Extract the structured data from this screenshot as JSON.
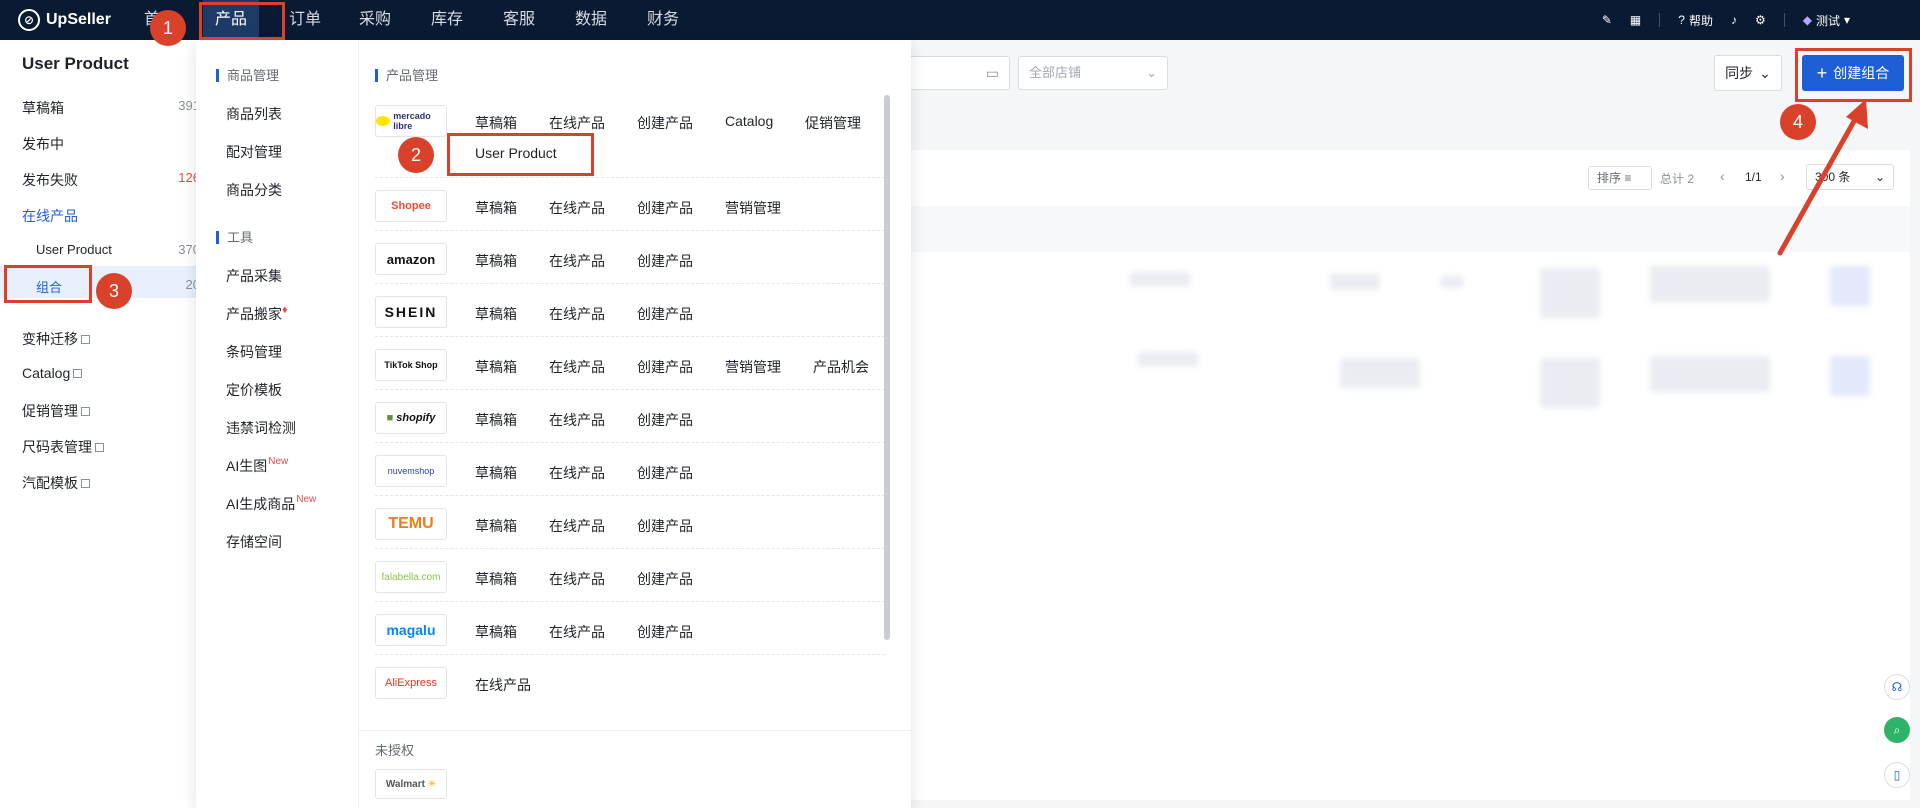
{
  "topnav": {
    "logo": "UpSeller",
    "items": [
      "首",
      "产品",
      "订单",
      "采购",
      "库存",
      "客服",
      "数据",
      "财务"
    ],
    "help": "帮助",
    "user": "测试"
  },
  "sidebar": {
    "title": "User Product",
    "items": [
      {
        "label": "草稿箱",
        "count": "391"
      },
      {
        "label": "发布中",
        "count": ""
      },
      {
        "label": "发布失败",
        "count": "126"
      },
      {
        "label": "在线产品",
        "count": ""
      },
      {
        "label": "User Product",
        "count": "370"
      },
      {
        "label": "组合",
        "count": "20"
      },
      {
        "label": "变种迁移",
        "count": ""
      },
      {
        "label": "Catalog",
        "count": ""
      },
      {
        "label": "促销管理",
        "count": ""
      },
      {
        "label": "尺码表管理",
        "count": ""
      },
      {
        "label": "汽配模板",
        "count": ""
      }
    ]
  },
  "toolbar": {
    "store_placeholder": "全部店铺",
    "sync": "同步",
    "create": "创建组合",
    "sort": "排序",
    "total": "总计 2",
    "page": "1/1",
    "per_page": "300 条"
  },
  "menu": {
    "left_section1": "商品管理",
    "left_items1": [
      "商品列表",
      "配对管理",
      "商品分类"
    ],
    "left_section2": "工具",
    "left_items2": [
      "产品采集",
      "产品搬家",
      "条码管理",
      "定价模板",
      "违禁词检测",
      "AI生图",
      "AI生成商品",
      "存储空间"
    ],
    "new_tag": "New",
    "right_section": "产品管理",
    "platforms": [
      {
        "logo": "mercado libre",
        "links": [
          "草稿箱",
          "在线产品",
          "创建产品",
          "Catalog",
          "促销管理"
        ],
        "sub": "User Product"
      },
      {
        "logo": "Shopee",
        "links": [
          "草稿箱",
          "在线产品",
          "创建产品",
          "营销管理"
        ]
      },
      {
        "logo": "amazon",
        "links": [
          "草稿箱",
          "在线产品",
          "创建产品"
        ]
      },
      {
        "logo": "SHEIN",
        "links": [
          "草稿箱",
          "在线产品",
          "创建产品"
        ]
      },
      {
        "logo": "TikTok Shop",
        "links": [
          "草稿箱",
          "在线产品",
          "创建产品",
          "营销管理",
          "产品机会"
        ]
      },
      {
        "logo": "shopify",
        "links": [
          "草稿箱",
          "在线产品",
          "创建产品"
        ]
      },
      {
        "logo": "nuvemshop",
        "links": [
          "草稿箱",
          "在线产品",
          "创建产品"
        ]
      },
      {
        "logo": "TEMU",
        "links": [
          "草稿箱",
          "在线产品",
          "创建产品"
        ]
      },
      {
        "logo": "falabella.com",
        "links": [
          "草稿箱",
          "在线产品",
          "创建产品"
        ]
      },
      {
        "logo": "magalu",
        "links": [
          "草稿箱",
          "在线产品",
          "创建产品"
        ]
      },
      {
        "logo": "AliExpress",
        "links": [
          "在线产品"
        ]
      }
    ],
    "unauth_title": "未授权",
    "unauth_logo": "Walmart"
  },
  "annotations": [
    "1",
    "2",
    "3",
    "4"
  ],
  "colors": {
    "accent": "#1f5fd6",
    "nav_bg": "#0b1a33",
    "annotation": "#d9412b"
  }
}
